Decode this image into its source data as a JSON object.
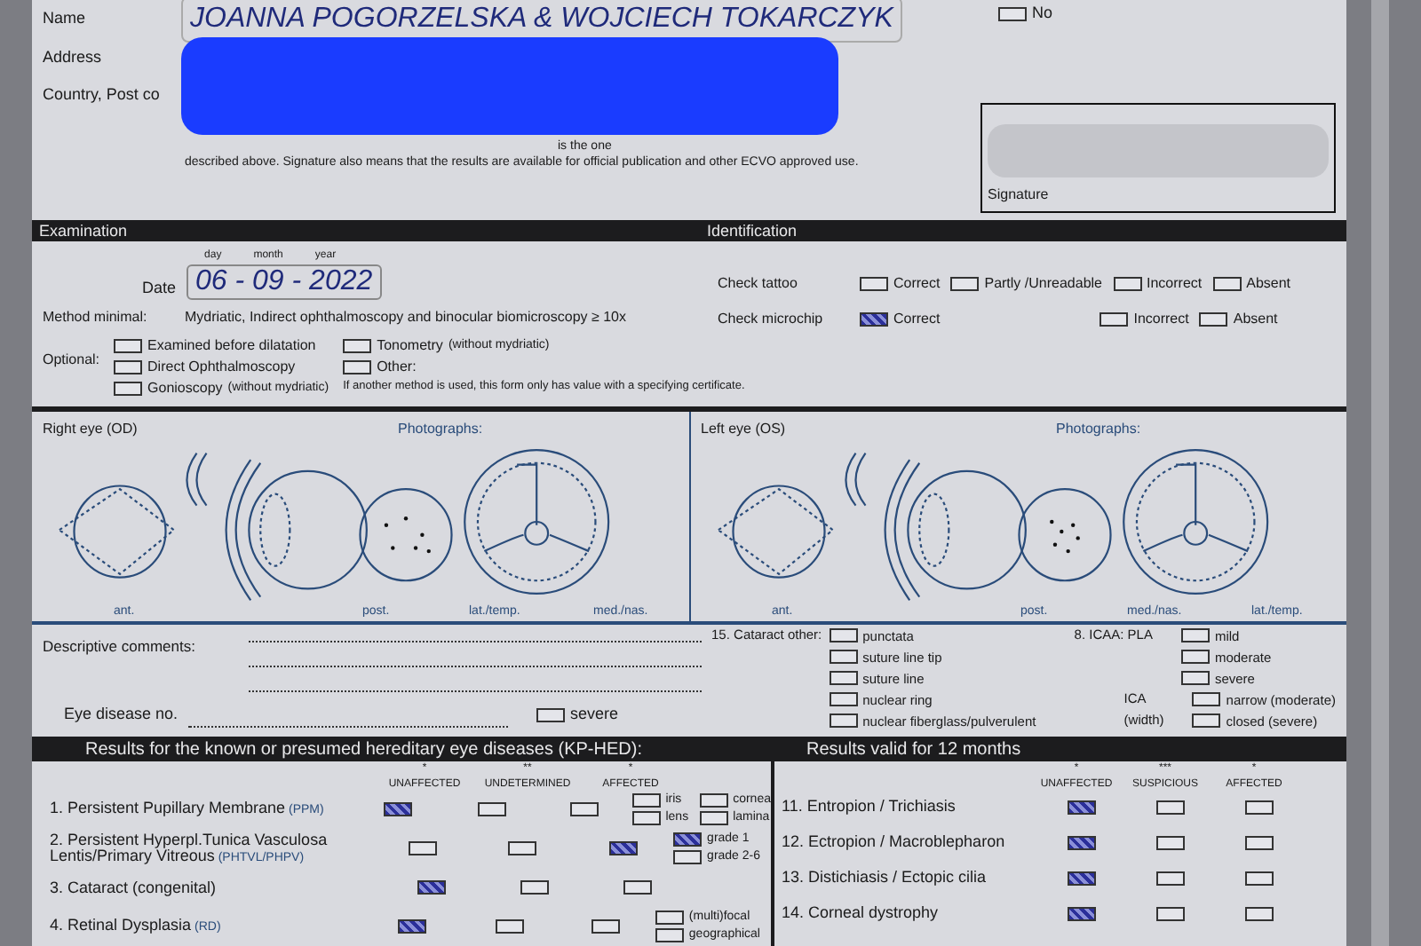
{
  "owner": {
    "name_label": "Name",
    "name_value": "JOANNA POGORZELSKA & WOJCIECH TOKARCZYK",
    "address_label": "Address",
    "country_label": "Country, Post co",
    "dna_option": {
      "label": "No",
      "checked": false
    },
    "declaration_end": "is the one",
    "declaration": "described above. Signature also means that the results are available for official publication and other ECVO approved use.",
    "signature_label": "Signature"
  },
  "examination": {
    "title": "Examination",
    "identification_title": "Identification",
    "date_label": "Date",
    "date_parts": [
      "day",
      "month",
      "year"
    ],
    "date_value": "06 - 09 - 2022",
    "tattoo_label": "Check tattoo",
    "tattoo_options": [
      {
        "label": "Correct",
        "checked": false
      },
      {
        "label": "Partly /Unreadable",
        "checked": false
      },
      {
        "label": "Incorrect",
        "checked": false
      },
      {
        "label": "Absent",
        "checked": false
      }
    ],
    "microchip_label": "Check microchip",
    "microchip_options": [
      {
        "label": "Correct",
        "checked": true
      },
      {
        "label": "Incorrect",
        "checked": false
      },
      {
        "label": "Absent",
        "checked": false
      }
    ],
    "method_label": "Method minimal:",
    "method_value": "Mydriatic, Indirect ophthalmoscopy and binocular biomicroscopy ≥ 10x",
    "optional_label": "Optional:",
    "optional_options": [
      {
        "label": "Examined before dilatation",
        "checked": false
      },
      {
        "label": "Direct Ophthalmoscopy",
        "checked": false
      },
      {
        "label": "Gonioscopy",
        "note": "(without mydriatic)",
        "checked": false
      }
    ],
    "optional_options_2": [
      {
        "label": "Tonometry",
        "note": "(without mydriatic)",
        "checked": false
      },
      {
        "label": "Other:",
        "checked": false
      }
    ],
    "method_note": "If another method is used, this form only has value with a specifying certificate."
  },
  "eyes": [
    {
      "title": "Right eye (OD)",
      "photographs_label": "Photographs:",
      "labels": [
        "ant.",
        "post.",
        "lat./temp.",
        "med./nas."
      ]
    },
    {
      "title": "Left eye (OS)",
      "photographs_label": "Photographs:",
      "labels": [
        "ant.",
        "post.",
        "med./nas.",
        "lat./temp."
      ]
    }
  ],
  "comments": {
    "label": "Descriptive comments:",
    "eye_disease_label": "Eye disease no.",
    "severe": {
      "label": "severe",
      "checked": false
    },
    "cataract_label": "15. Cataract other:",
    "cataract_options": [
      {
        "label": "punctata",
        "checked": false
      },
      {
        "label": "suture line tip",
        "checked": false
      },
      {
        "label": "suture line",
        "checked": false
      },
      {
        "label": "nuclear ring",
        "checked": false
      },
      {
        "label": "nuclear fiberglass/pulverulent",
        "checked": false
      }
    ],
    "icaa_label": "8. ICAA: PLA",
    "icaa_options": [
      {
        "label": "mild",
        "checked": false
      },
      {
        "label": "moderate",
        "checked": false
      },
      {
        "label": "severe",
        "checked": false
      }
    ],
    "ica_label": [
      "ICA",
      "(width)"
    ],
    "ica_options": [
      {
        "label": "narrow (moderate)",
        "checked": false
      },
      {
        "label": "closed (severe)",
        "checked": false
      }
    ]
  },
  "hereditary": {
    "title": "Results for the known or presumed hereditary eye diseases (KP-HED):",
    "columns": [
      {
        "stars": "*",
        "label": "UNAFFECTED"
      },
      {
        "stars": "**",
        "label": "UNDETERMINED"
      },
      {
        "stars": "*",
        "label": "AFFECTED"
      }
    ],
    "rows": [
      {
        "name": "1. Persistent Pupillary Membrane",
        "abbr": "(PPM)",
        "checks": [
          true,
          false,
          false
        ],
        "sub": [
          {
            "label": "iris",
            "checked": false
          },
          {
            "label": "lens",
            "checked": false
          }
        ],
        "extra": [
          {
            "label": "cornea",
            "checked": false
          },
          {
            "label": "lamina",
            "checked": false
          }
        ]
      },
      {
        "name": "2. Persistent Hyperpl.Tunica Vasculosa Lentis/Primary Vitreous",
        "abbr": "(PHTVL/PHPV)",
        "checks": [
          false,
          false,
          true
        ],
        "sub": [
          {
            "label": "grade 1",
            "checked": true
          },
          {
            "label": "grade 2-6",
            "checked": false
          }
        ]
      },
      {
        "name": "3. Cataract (congenital)",
        "checks": [
          true,
          false,
          false
        ]
      },
      {
        "name": "4. Retinal Dysplasia",
        "abbr": "(RD)",
        "checks": [
          true,
          false,
          false
        ],
        "sub": [
          {
            "label": "(multi)focal",
            "checked": false
          },
          {
            "label": "geographical",
            "checked": false
          }
        ]
      }
    ]
  },
  "annual": {
    "title": "Results valid for 12 months",
    "columns": [
      {
        "stars": "*",
        "label": "UNAFFECTED"
      },
      {
        "stars": "***",
        "label": "SUSPICIOUS"
      },
      {
        "stars": "*",
        "label": "AFFECTED"
      }
    ],
    "rows": [
      {
        "name": "11. Entropion / Trichiasis",
        "checks": [
          true,
          false,
          false
        ]
      },
      {
        "name": "12. Ectropion / Macroblepharon",
        "checks": [
          true,
          false,
          false
        ]
      },
      {
        "name": "13. Distichiasis / Ectopic cilia",
        "checks": [
          true,
          false,
          false
        ]
      },
      {
        "name": "14. Corneal dystrophy",
        "checks": [
          true,
          false,
          false
        ]
      }
    ]
  }
}
